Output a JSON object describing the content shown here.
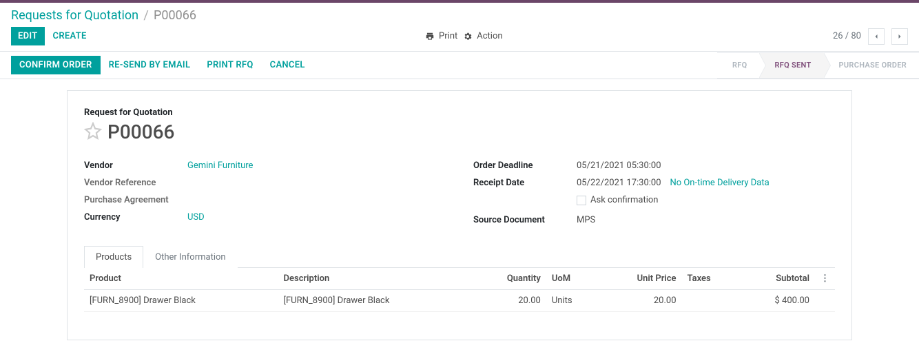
{
  "colors": {
    "accent": "#00a09d",
    "muted": "#adb5bd",
    "active_status": "#7d4c79"
  },
  "breadcrumb": {
    "root": "Requests for Quotation",
    "current": "P00066"
  },
  "toolbar": {
    "edit": "EDIT",
    "create": "CREATE",
    "print": "Print",
    "action": "Action",
    "pager": "26 / 80"
  },
  "actions": {
    "confirm": "CONFIRM ORDER",
    "resend": "RE-SEND BY EMAIL",
    "print_rfq": "PRINT RFQ",
    "cancel": "CANCEL"
  },
  "status": {
    "rfq": "RFQ",
    "rfq_sent": "RFQ SENT",
    "po": "PURCHASE ORDER"
  },
  "sheet": {
    "title_label": "Request for Quotation",
    "name": "P00066",
    "left": {
      "vendor_label": "Vendor",
      "vendor": "Gemini Furniture",
      "vendor_ref_label": "Vendor Reference",
      "purchase_agreement_label": "Purchase Agreement",
      "currency_label": "Currency",
      "currency": "USD"
    },
    "right": {
      "deadline_label": "Order Deadline",
      "deadline": "05/21/2021 05:30:00",
      "receipt_label": "Receipt Date",
      "receipt": "05/22/2021 17:30:00",
      "ontime_note": "No On-time Delivery Data",
      "ask_confirm": "Ask confirmation",
      "source_label": "Source Document",
      "source": "MPS"
    }
  },
  "tabs": {
    "products": "Products",
    "other": "Other Information"
  },
  "table": {
    "headers": {
      "product": "Product",
      "description": "Description",
      "quantity": "Quantity",
      "uom": "UoM",
      "unit_price": "Unit Price",
      "taxes": "Taxes",
      "subtotal": "Subtotal"
    },
    "rows": [
      {
        "product": "[FURN_8900] Drawer Black",
        "description": "[FURN_8900] Drawer Black",
        "quantity": "20.00",
        "uom": "Units",
        "unit_price": "20.00",
        "taxes": "",
        "subtotal": "$ 400.00"
      }
    ]
  }
}
